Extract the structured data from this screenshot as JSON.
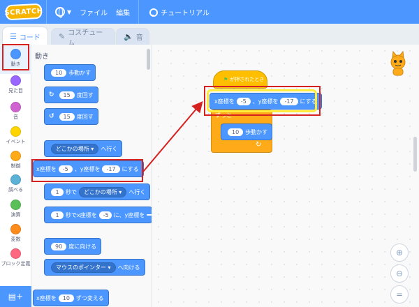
{
  "menubar": {
    "logo": "SCRATCH",
    "file": "ファイル",
    "edit": "編集",
    "tutorial": "チュートリアル"
  },
  "tabs": {
    "code": "コード",
    "costume": "コスチューム",
    "sound": "音"
  },
  "categories": [
    {
      "label": "動き",
      "color": "#4c97ff"
    },
    {
      "label": "見た目",
      "color": "#9966ff"
    },
    {
      "label": "音",
      "color": "#cf63cf"
    },
    {
      "label": "イベント",
      "color": "#ffd500"
    },
    {
      "label": "制御",
      "color": "#ffab19"
    },
    {
      "label": "調べる",
      "color": "#5cb1d6"
    },
    {
      "label": "演算",
      "color": "#59c059"
    },
    {
      "label": "変数",
      "color": "#ff8c1a"
    },
    {
      "label": "ブロック定義",
      "color": "#ff6680"
    }
  ],
  "palette": {
    "title": "動き",
    "move": {
      "value": "10",
      "text": "歩動かす"
    },
    "turn_right": {
      "value": "15",
      "text": "度回す"
    },
    "turn_left": {
      "value": "15",
      "text": "度回す"
    },
    "goto": {
      "dropdown": "どこかの場所",
      "text": "へ行く"
    },
    "gotoxy": {
      "x_label": "x座標を",
      "x": "-5",
      "sep": "、y座標を",
      "y": "-17",
      "text": "にする"
    },
    "glide": {
      "value": "1",
      "mid": "秒で",
      "dropdown": "どこかの場所",
      "text": "へ行く"
    },
    "glidexy": {
      "value": "1",
      "mid": "秒でx座標を",
      "x": "-5",
      "sep": "に、y座標を",
      "y": ""
    },
    "point": {
      "value": "90",
      "text": "度に向ける"
    },
    "pointto": {
      "dropdown": "マウスのポインター",
      "text": "へ向ける"
    },
    "changex": {
      "label": "x座標を",
      "value": "10",
      "text": "ずつ変える"
    }
  },
  "script": {
    "hat": "が押されたとき",
    "gotoxy": {
      "x_label": "x座標を",
      "x": "-5",
      "sep": "、y座標を",
      "y": "-17",
      "text": "にする"
    },
    "forever": "ずっと",
    "move": {
      "value": "10",
      "text": "歩動かす"
    }
  },
  "colors": {
    "motion": "#4c97ff",
    "highlight_red": "#d62121",
    "highlight_yellow": "#ffeb3b"
  }
}
